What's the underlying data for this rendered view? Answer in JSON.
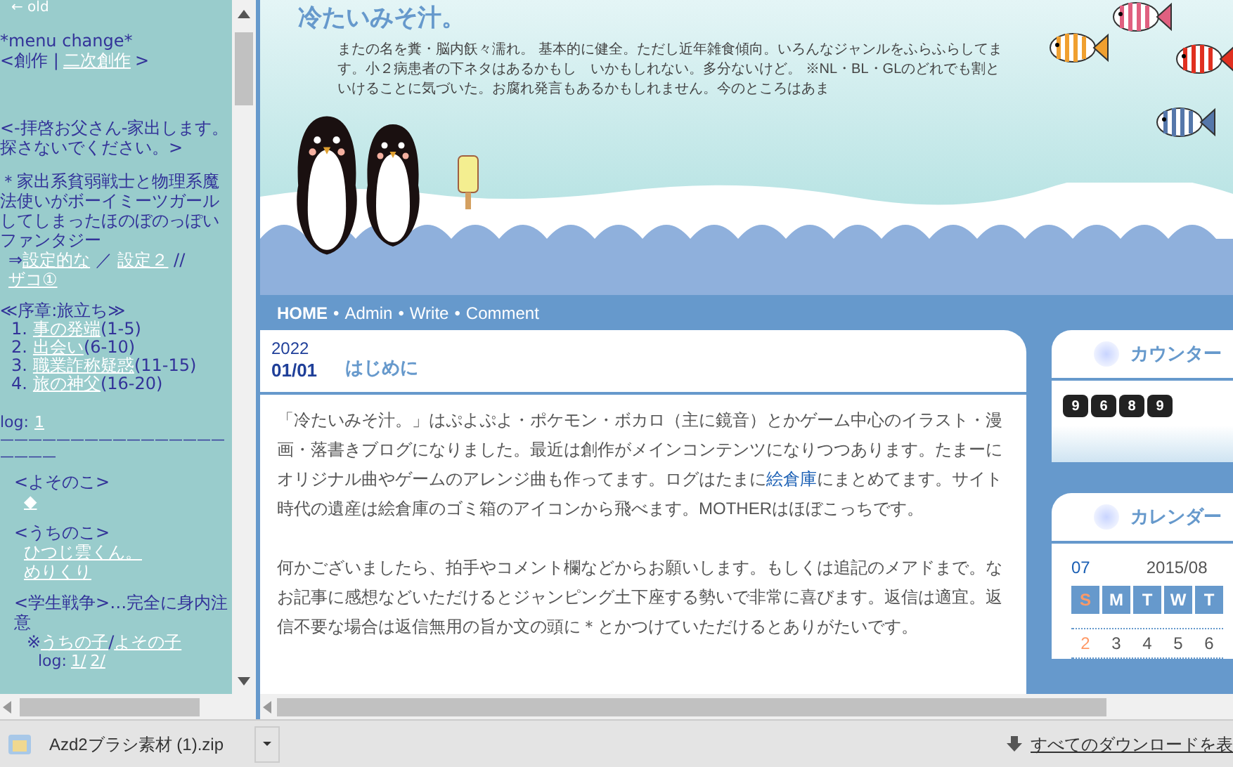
{
  "menu_frame": {
    "back_link": "← old",
    "menu_change": "*menu change*",
    "genre": {
      "open": "<",
      "current": "創作",
      "separator": "|",
      "link": "二次創作",
      "close": ">"
    },
    "story_title": "<-拝啓お父さん-家出します。探さないでください。>",
    "story_summary": "＊家出系貧弱戦士と物理系魔法使いがボーイミーツガールしてしまったほのぼのっぽいファンタジー",
    "settings": {
      "arrow": "⇒",
      "links": [
        "設定的な",
        "設定２",
        "ザコ①"
      ],
      "separators": [
        "／",
        "//"
      ]
    },
    "chapter": "≪序章:旅立ち≫",
    "episodes": [
      {
        "number": "1.",
        "title": "事の発端",
        "range": "(1-5)"
      },
      {
        "number": "2.",
        "title": "出会い",
        "range": "(6-10)"
      },
      {
        "number": "3.",
        "title": "職業詐称疑惑",
        "range": "(11-15)"
      },
      {
        "number": "4.",
        "title": "旅の神父",
        "range": "(16-20)"
      }
    ],
    "log_label": "log:",
    "log_links": [
      "1"
    ],
    "divider": "————————————————————",
    "others_heading": "<よそのこ>",
    "others_links": [
      "◆"
    ],
    "ours_heading": "<うちのこ>",
    "ours_links": [
      "ひつじ雲くん。",
      "めりくり"
    ],
    "war_heading": "<学生戦争>…完全に身内注意",
    "war_mark": "※",
    "war_links": [
      "うちの子",
      "よその子"
    ],
    "war_separator": "/",
    "war_log_label": "log:",
    "war_log_links": [
      "1/",
      "2/"
    ]
  },
  "blog": {
    "title": "冷たいみそ汁。",
    "description": "またの名を糞・脳内飫々濡れ。 基本的に健全。ただし近年雑食傾向。いろんなジャンルをふらふらしてます。小２病患者の下ネタはあるかもし　いかもしれない。多分ないけど。 ※NL・BL・GLのどれでも割といけることに気づいた。お腐れ発言もあるかもしれません。今のところはあま",
    "nav": [
      {
        "label": "HOME",
        "bold": true
      },
      {
        "label": "Admin",
        "bold": false
      },
      {
        "label": "Write",
        "bold": false
      },
      {
        "label": "Comment",
        "bold": false
      }
    ],
    "nav_separator": "•",
    "post": {
      "year": "2022",
      "date": "01/01",
      "title": "はじめに",
      "paragraphs": [
        {
          "kind": "with_link",
          "before": "「冷たいみそ汁。」はぷよぷよ・ポケモン・ボカロ（主に鏡音）とかゲーム中心のイラスト・漫画・落書きブログになりました。最近は創作がメインコンテンツになりつつあります。たまーにオリジナル曲やゲームのアレンジ曲も作ってます。ログはたまに",
          "link": "絵倉庫",
          "after": "にまとめてます。サイト時代の遺産は絵倉庫のゴミ箱のアイコンから飛べます。MOTHERはほぼこっちです。"
        },
        {
          "kind": "plain",
          "text": "何かございましたら、拍手やコメント欄などからお願いします。もしくは追記のメアドまで。なお記事に感想などいただけるとジャンピング土下座する勢いで非常に喜びます。返信は適宜。返信不要な場合は返信無用の旨か文の頭に＊とかつけていただけるとありがたいです。"
        }
      ]
    },
    "sidebar": {
      "counter": {
        "title": "カウンター",
        "digits": [
          "9",
          "6",
          "8",
          "9"
        ]
      },
      "calendar": {
        "title": "カレンダー",
        "prev": "07",
        "month": "2015/08",
        "weekdays": [
          {
            "label": "S",
            "color": "#ff9966"
          },
          {
            "label": "M",
            "color": "#ffffff"
          },
          {
            "label": "T",
            "color": "#ffffff"
          },
          {
            "label": "W",
            "color": "#ffffff"
          },
          {
            "label": "T",
            "color": "#ffffff"
          }
        ],
        "days": [
          {
            "label": "2",
            "color": "#ff9966"
          },
          {
            "label": "3",
            "color": "#555555"
          },
          {
            "label": "4",
            "color": "#555555"
          },
          {
            "label": "5",
            "color": "#555555"
          },
          {
            "label": "6",
            "color": "#555555"
          }
        ]
      }
    }
  },
  "download_bar": {
    "file": "Azd2ブラシ素材 (1).zip",
    "show_all": "すべてのダウンロードを表"
  }
}
